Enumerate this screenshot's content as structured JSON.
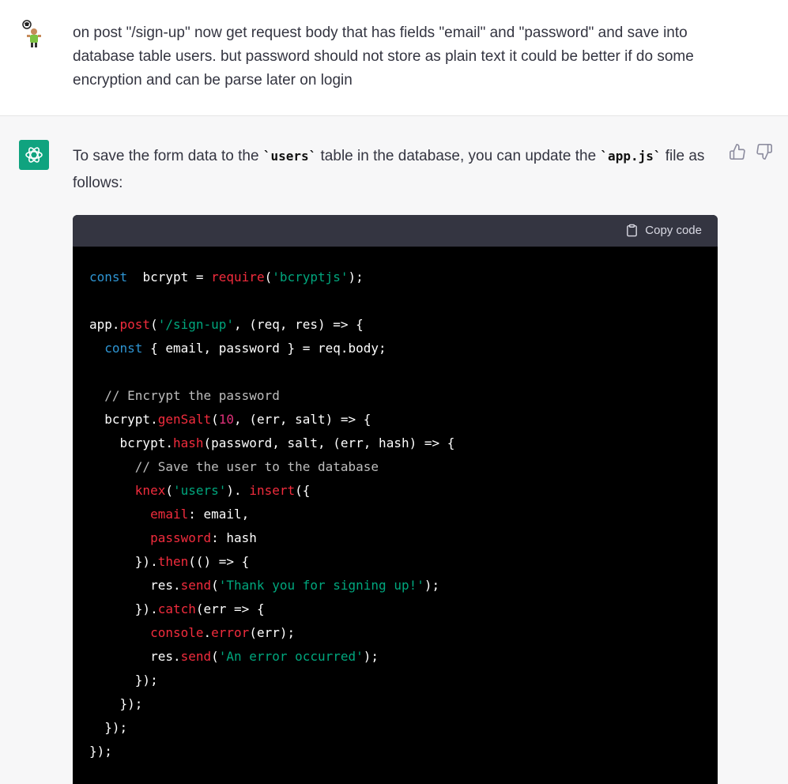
{
  "user_message": {
    "text": "on post \"/sign-up\" now get request body that has fields \"email\" and \"password\" and save into database table users. but password should not store as plain text it could be better if do some encryption and can be parse later on login"
  },
  "assistant_message": {
    "intro_prefix": "To save the form data to the ",
    "intro_code1": "`users`",
    "intro_middle": " table in the database, you can update the ",
    "intro_code2": "`app.js`",
    "intro_suffix": " file as follows:",
    "copy_label": "Copy code"
  },
  "code_lines": [
    [
      [
        "kw",
        "const"
      ],
      [
        "",
        "  bcrypt = "
      ],
      [
        "fn",
        "require"
      ],
      [
        "",
        "("
      ],
      [
        "str",
        "'bcryptjs'"
      ],
      [
        "",
        ");"
      ]
    ],
    [],
    [
      [
        "",
        "app."
      ],
      [
        "fn",
        "post"
      ],
      [
        "",
        "("
      ],
      [
        "str",
        "'/sign-up'"
      ],
      [
        "",
        ", (req, res) => {"
      ]
    ],
    [
      [
        "",
        "  "
      ],
      [
        "kw",
        "const"
      ],
      [
        "",
        " { email, password } = req.body;"
      ]
    ],
    [],
    [
      [
        "",
        "  "
      ],
      [
        "cm",
        "// Encrypt the password"
      ]
    ],
    [
      [
        "",
        "  bcrypt."
      ],
      [
        "fn",
        "genSalt"
      ],
      [
        "",
        "("
      ],
      [
        "num",
        "10"
      ],
      [
        "",
        ", (err, salt) => {"
      ]
    ],
    [
      [
        "",
        "    bcrypt."
      ],
      [
        "fn",
        "hash"
      ],
      [
        "",
        "(password, salt, (err, hash) => {"
      ]
    ],
    [
      [
        "",
        "      "
      ],
      [
        "cm",
        "// Save the user to the database"
      ]
    ],
    [
      [
        "",
        "      "
      ],
      [
        "fn",
        "knex"
      ],
      [
        "",
        "("
      ],
      [
        "str",
        "'users'"
      ],
      [
        "",
        "). "
      ],
      [
        "fn",
        "insert"
      ],
      [
        "",
        "({"
      ]
    ],
    [
      [
        "",
        "        "
      ],
      [
        "fn",
        "email"
      ],
      [
        "",
        ": email,"
      ]
    ],
    [
      [
        "",
        "        "
      ],
      [
        "fn",
        "password"
      ],
      [
        "",
        ": hash"
      ]
    ],
    [
      [
        "",
        "      })."
      ],
      [
        "fn",
        "then"
      ],
      [
        "",
        "(() => {"
      ]
    ],
    [
      [
        "",
        "        res."
      ],
      [
        "fn",
        "send"
      ],
      [
        "",
        "("
      ],
      [
        "str",
        "'Thank you for signing up!'"
      ],
      [
        "",
        ");"
      ]
    ],
    [
      [
        "",
        "      })."
      ],
      [
        "fn",
        "catch"
      ],
      [
        "",
        "(err => {"
      ]
    ],
    [
      [
        "",
        "        "
      ],
      [
        "fn",
        "console"
      ],
      [
        "",
        "."
      ],
      [
        "fn",
        "error"
      ],
      [
        "",
        "(err);"
      ]
    ],
    [
      [
        "",
        "        res."
      ],
      [
        "fn",
        "send"
      ],
      [
        "",
        "("
      ],
      [
        "str",
        "'An error occurred'"
      ],
      [
        "",
        ");"
      ]
    ],
    [
      [
        "",
        "      });"
      ]
    ],
    [
      [
        "",
        "    });"
      ]
    ],
    [
      [
        "",
        "  });"
      ]
    ],
    [
      [
        "",
        "});"
      ]
    ]
  ],
  "colors": {
    "accent_green": "#10a37f",
    "code_bg": "#000000",
    "code_header_bg": "#343541"
  },
  "icons": {
    "user_avatar": "soccer-player-avatar",
    "assistant_avatar": "openai-logo-icon",
    "copy": "clipboard-icon",
    "thumbs_up": "thumbs-up-icon",
    "thumbs_down": "thumbs-down-icon"
  }
}
